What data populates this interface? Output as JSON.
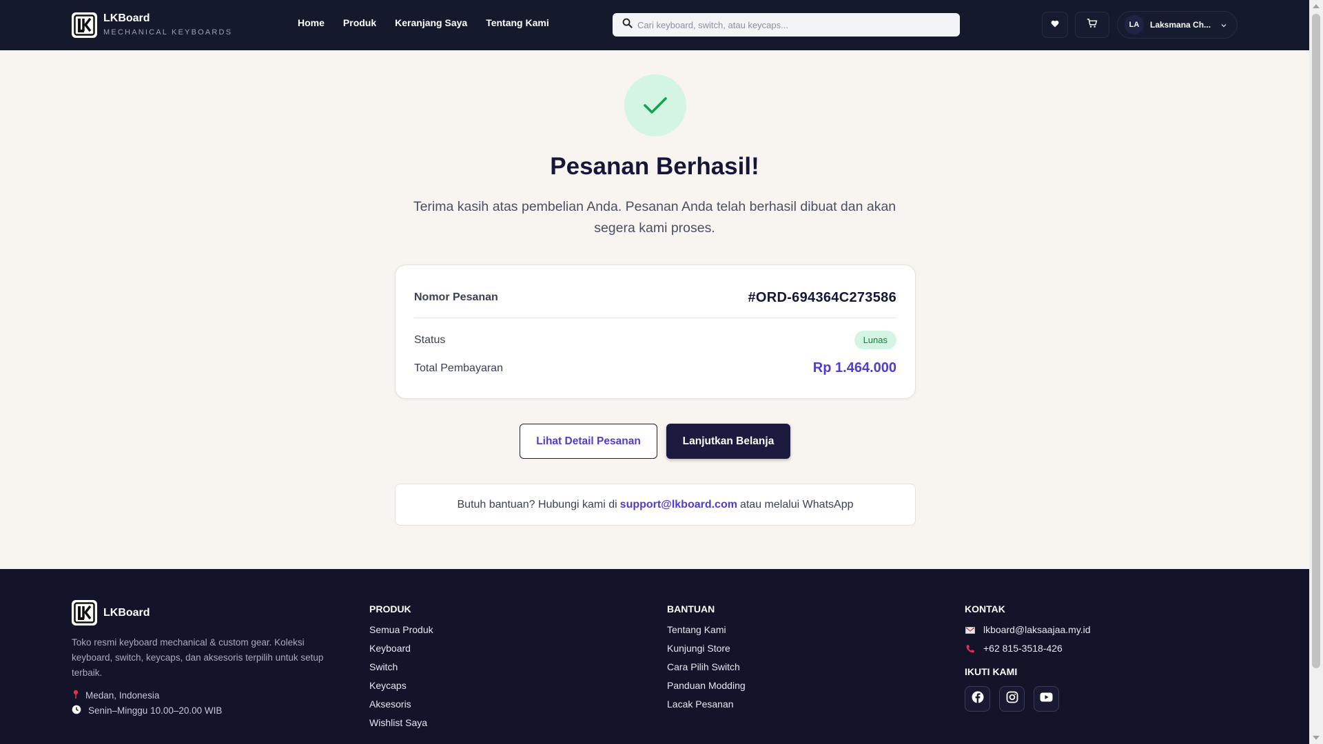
{
  "header": {
    "brand_name": "LKBoard",
    "brand_tagline": "MECHANICAL KEYBOARDS",
    "nav": [
      {
        "label": "Home"
      },
      {
        "label": "Produk"
      },
      {
        "label": "Keranjang Saya"
      },
      {
        "label": "Tentang Kami"
      }
    ],
    "search_placeholder": "Cari keyboard, switch, atau keycaps...",
    "user_initials": "LA",
    "user_name": "Laksmana Ch..."
  },
  "confirmation": {
    "title": "Pesanan Berhasil!",
    "subtitle": "Terima kasih atas pembelian Anda. Pesanan Anda telah berhasil dibuat dan akan segera kami proses.",
    "order_label": "Nomor Pesanan",
    "order_number": "#ORD-694364C273586",
    "status_label": "Status",
    "status_value": "Lunas",
    "total_label": "Total Pembayaran",
    "total_value": "Rp 1.464.000",
    "btn_detail": "Lihat Detail Pesanan",
    "btn_continue": "Lanjutkan Belanja",
    "help_prefix": "Butuh bantuan? Hubungi kami di",
    "help_email": "support@lkboard.com",
    "help_suffix": "atau melalui WhatsApp"
  },
  "footer": {
    "brand_name": "LKBoard",
    "description": "Toko resmi keyboard mechanical & custom gear. Koleksi keyboard, switch, keycaps, dan aksesoris terpilih untuk setup terbaik.",
    "location": "Medan, Indonesia",
    "hours": "Senin–Minggu 10.00–20.00 WIB",
    "produk": {
      "heading": "PRODUK",
      "items": [
        "Semua Produk",
        "Keyboard",
        "Switch",
        "Keycaps",
        "Aksesoris",
        "Wishlist Saya"
      ]
    },
    "bantuan": {
      "heading": "BANTUAN",
      "items": [
        "Tentang Kami",
        "Kunjungi Store",
        "Cara Pilih Switch",
        "Panduan Modding",
        "Lacak Pesanan"
      ]
    },
    "kontak": {
      "heading": "KONTAK",
      "email": "lkboard@laksaajaa.my.id",
      "phone": "+62 815-3518-426",
      "follow_heading": "IKUTI KAMI"
    }
  },
  "colors": {
    "header_bg": "#141a2c",
    "page_bg": "#f8f4ef",
    "accent": "#4f3bd6",
    "success": "#15803d",
    "footer_bg": "#13132a"
  }
}
